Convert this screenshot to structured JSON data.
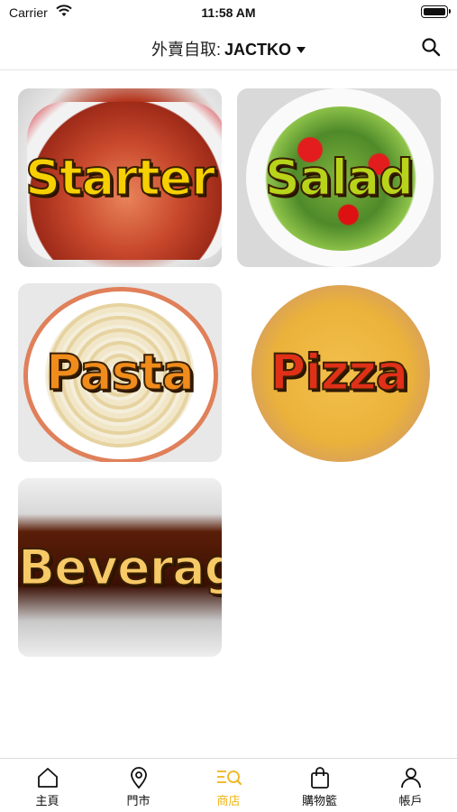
{
  "status": {
    "carrier": "Carrier",
    "time": "11:58 AM"
  },
  "header": {
    "prefix": "外賣自取:",
    "store": "JACTKO"
  },
  "categories": [
    {
      "label": "Starter"
    },
    {
      "label": "Salad"
    },
    {
      "label": "Pasta"
    },
    {
      "label": "Pizza"
    },
    {
      "label": "Beverage"
    }
  ],
  "tabs": [
    {
      "label": "主頁",
      "icon": "home-icon"
    },
    {
      "label": "門市",
      "icon": "location-pin-icon"
    },
    {
      "label": "商店",
      "icon": "shop-menu-icon",
      "active": true
    },
    {
      "label": "購物籃",
      "icon": "shopping-bag-icon"
    },
    {
      "label": "帳戶",
      "icon": "user-icon"
    }
  ],
  "colors": {
    "accent": "#f0b41a",
    "text": "#111111"
  }
}
